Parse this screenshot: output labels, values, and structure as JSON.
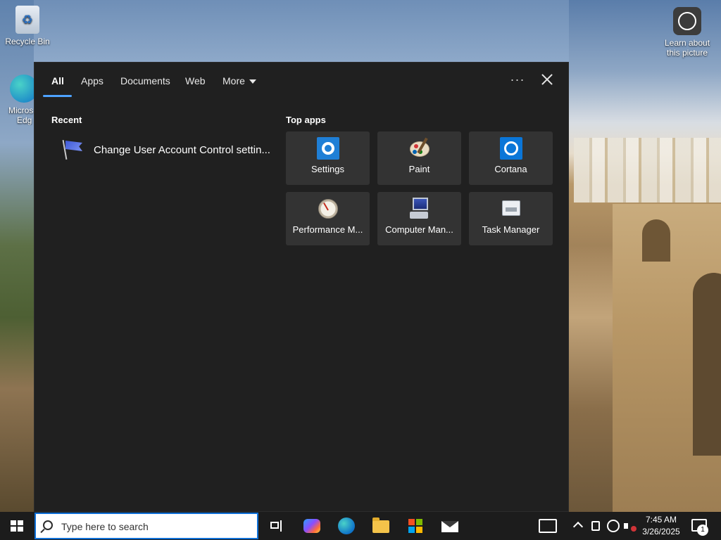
{
  "desktop": {
    "icons": [
      {
        "label": "Recycle Bin"
      },
      {
        "label": "Microsoft Edge",
        "label_line1": "Micros",
        "label_line2": "Edg"
      },
      {
        "label_line1": "Learn about",
        "label_line2": "this picture"
      }
    ]
  },
  "search_panel": {
    "tabs": [
      {
        "label": "All",
        "active": true
      },
      {
        "label": "Apps"
      },
      {
        "label": "Documents"
      },
      {
        "label": "Web"
      },
      {
        "label": "More"
      }
    ],
    "options_label": "···",
    "recent": {
      "title": "Recent",
      "items": [
        {
          "label": "Change User Account Control settin...",
          "icon": "uac-flag-icon"
        }
      ]
    },
    "top_apps": {
      "title": "Top apps",
      "apps": [
        {
          "label": "Settings",
          "icon": "settings-gear-icon"
        },
        {
          "label": "Paint",
          "icon": "paint-palette-icon"
        },
        {
          "label": "Cortana",
          "icon": "cortana-ring-icon"
        },
        {
          "label": "Performance M...",
          "icon": "performance-monitor-icon"
        },
        {
          "label": "Computer Man...",
          "icon": "computer-management-icon"
        },
        {
          "label": "Task Manager",
          "icon": "task-manager-icon"
        }
      ]
    }
  },
  "taskbar": {
    "search_placeholder": "Type here to search",
    "pinned": [
      "task-view-icon",
      "copilot-icon",
      "edge-icon",
      "file-explorer-icon",
      "store-icon",
      "mail-icon"
    ],
    "clock": {
      "time": "7:45 AM",
      "date": "3/26/2025"
    },
    "notification_count": "1"
  },
  "colors": {
    "panel_bg": "#202020",
    "tile_bg": "#333333",
    "accent": "#4ea3ff",
    "taskbar_bg": "#1c1c1c"
  }
}
